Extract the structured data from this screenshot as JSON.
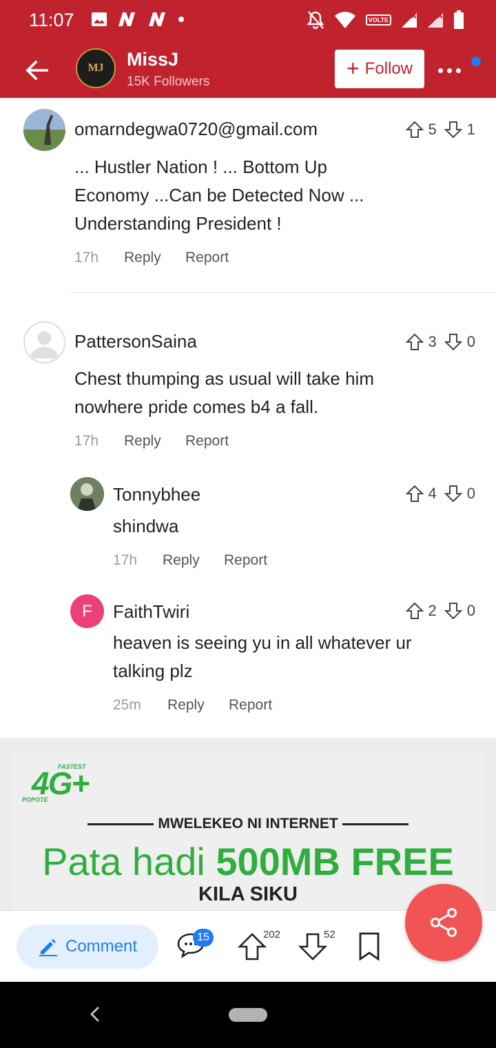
{
  "status_bar": {
    "time": "11:07",
    "icons_left": [
      "image-icon",
      "n-app-icon",
      "n-app-icon",
      "dot-icon"
    ],
    "icons_right": [
      "bell-off-icon",
      "wifi-icon",
      "volte-icon",
      "signal-icon",
      "signal-icon",
      "battery-icon"
    ],
    "volte_label": "VOLTE"
  },
  "header": {
    "author_name": "MissJ",
    "followers": "15K Followers",
    "logo_text": "MJ",
    "follow_label": "Follow",
    "accent_color": "#c0222e"
  },
  "comments": [
    {
      "name": "omarndegwa0720@gmail.com",
      "text_lines": [
        "... Hustler Nation ! ... Bottom Up",
        "Economy ...Can be Detected Now ...",
        "Understanding President !"
      ],
      "time": "17h",
      "reply": "Reply",
      "report": "Report",
      "up": "5",
      "down": "1"
    },
    {
      "name": "PattersonSaina",
      "text_lines": [
        "Chest thumping as usual will take him",
        "nowhere pride comes b4 a fall."
      ],
      "time": "17h",
      "reply": "Reply",
      "report": "Report",
      "up": "3",
      "down": "0"
    },
    {
      "name": "Tonnybhee",
      "text_lines": [
        "shindwa"
      ],
      "time": "17h",
      "reply": "Reply",
      "report": "Report",
      "up": "4",
      "down": "0"
    },
    {
      "name": "FaithTwiri",
      "avatar_letter": "F",
      "text_lines": [
        "heaven is seeing yu in all whatever ur",
        "talking plz"
      ],
      "time": "25m",
      "reply": "Reply",
      "report": "Report",
      "up": "2",
      "down": "0"
    }
  ],
  "ad": {
    "logo_main": "4G+",
    "logo_top": "FASTEST",
    "logo_bottom": "POPOTE",
    "tagline": "MWELEKEO NI INTERNET",
    "promo_light": "Pata hadi ",
    "promo_bold": "500MB FREE",
    "sub": "KILA SIKU"
  },
  "action_bar": {
    "comment_label": "Comment",
    "comment_count": "15",
    "upvotes": "202",
    "downvotes": "52"
  }
}
